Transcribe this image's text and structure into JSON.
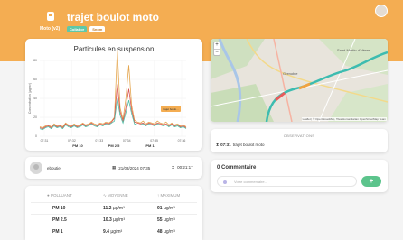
{
  "header": {
    "title": "trajet boulot moto",
    "moto_label": "Moto (v2)",
    "tags": [
      "Collabor",
      "Snom"
    ],
    "icon": "motorcycle-icon"
  },
  "chart": {
    "title": "Particules en suspension",
    "ylabel": "Concentration (µg/m³)",
    "legend": [
      "PM 10",
      "PM 2.5",
      "PM 1"
    ],
    "tooltip": "trajet boulo..."
  },
  "chart_data": {
    "type": "line",
    "title": "Particules en suspension",
    "ylabel": "Concentration (µg/m³)",
    "xlabel": "",
    "ylim": [
      0,
      80
    ],
    "y_ticks": [
      0,
      20,
      40,
      60,
      80
    ],
    "x_ticks": [
      "07:31",
      "07:32",
      "07:33",
      "07:34",
      "07:35",
      "07:36"
    ],
    "grid": true,
    "legend": "bottom",
    "series": [
      {
        "name": "PM 10",
        "color": "#e4a64f",
        "values": [
          10,
          9,
          11,
          12,
          10,
          13,
          11,
          12,
          10,
          14,
          12,
          11,
          13,
          11,
          12,
          14,
          12,
          13,
          15,
          13,
          12,
          14,
          13,
          15,
          14,
          16,
          20,
          91,
          30,
          18,
          40,
          75,
          33,
          17,
          15,
          14,
          16,
          13,
          15,
          14,
          13,
          16,
          14,
          13,
          15,
          12,
          14,
          12,
          13,
          11,
          12,
          10
        ]
      },
      {
        "name": "PM 2.5",
        "color": "#d9534f",
        "values": [
          9,
          8,
          10,
          11,
          9,
          12,
          10,
          11,
          9,
          13,
          11,
          10,
          12,
          10,
          11,
          13,
          11,
          12,
          14,
          12,
          11,
          13,
          12,
          14,
          13,
          15,
          19,
          55,
          26,
          16,
          30,
          50,
          28,
          15,
          14,
          13,
          14,
          12,
          14,
          13,
          12,
          14,
          13,
          12,
          13,
          11,
          13,
          11,
          12,
          10,
          11,
          9
        ]
      },
      {
        "name": "PM 1",
        "color": "#4fbfa6",
        "values": [
          8,
          7,
          9,
          10,
          8,
          11,
          9,
          10,
          8,
          12,
          10,
          9,
          11,
          9,
          10,
          12,
          10,
          11,
          13,
          11,
          10,
          12,
          11,
          13,
          12,
          14,
          16,
          40,
          22,
          14,
          25,
          38,
          24,
          13,
          12,
          12,
          13,
          11,
          13,
          12,
          11,
          13,
          12,
          11,
          12,
          10,
          12,
          10,
          11,
          9,
          10,
          8
        ]
      }
    ]
  },
  "map": {
    "labels": [
      "Saint-Martin-d'Hères",
      "Grenoble"
    ],
    "attribution": "Leaflet | © OpenStreetMap, Tiles Humanitarian OpenStreetMap Team",
    "zoom_in": "+",
    "zoom_out": "−"
  },
  "observations": {
    "header": "OBSERVATIONS",
    "time": "07:31",
    "text": "trajet boulot moto"
  },
  "comments": {
    "title": "0 Commentaire",
    "placeholder": "Votre commentaire...",
    "send_label": "+"
  },
  "info": {
    "user": "eboutie",
    "date": "21/03/2024 07:35",
    "duration": "00:21:17"
  },
  "table": {
    "headers": [
      "POLLUANT",
      "MOYENNE",
      "MAXIMUM"
    ],
    "rows": [
      {
        "pollutant": "PM 10",
        "avg": "11.2",
        "max": "91"
      },
      {
        "pollutant": "PM 2.5",
        "avg": "10.3",
        "max": "55"
      },
      {
        "pollutant": "PM 1",
        "avg": "9.4",
        "max": "48"
      }
    ],
    "unit": "µg/m³"
  },
  "colors": {
    "header": "#f4ad52",
    "accent": "#5cc48c"
  }
}
